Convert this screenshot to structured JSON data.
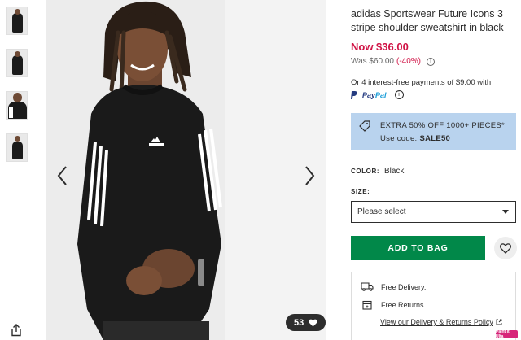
{
  "product": {
    "title": "adidas Sportswear Future Icons 3 stripe shoulder sweatshirt in black",
    "price_now": "Now $36.00",
    "was_price": "Was $60.00",
    "discount": "(-40%)",
    "installments": "Or 4 interest-free payments of $9.00 with",
    "paypal_part1": "Pay",
    "paypal_part2": "Pal"
  },
  "promo": {
    "line1": "EXTRA 50% OFF 1000+ PIECES*",
    "use_code_label": "Use code:",
    "code": "SALE50"
  },
  "color": {
    "label": "COLOR:",
    "value": "Black"
  },
  "size": {
    "label": "SIZE:",
    "placeholder": "Please select"
  },
  "actions": {
    "add_to_bag": "ADD TO BAG",
    "save_count": "53"
  },
  "delivery": {
    "free_delivery": "Free Delivery.",
    "free_returns": "Free Returns",
    "policy_link": "View our Delivery & Returns Policy"
  },
  "badge": {
    "text": "Paint It Ulta"
  },
  "icons": {
    "share": "share-icon",
    "prev": "chevron-left-icon",
    "next": "chevron-right-icon",
    "heart": "heart-icon",
    "tag": "tag-icon",
    "truck": "truck-icon",
    "returns": "returns-icon",
    "external": "external-link-icon"
  },
  "colors": {
    "sale_red": "#d01345",
    "bag_green": "#018849",
    "promo_blue": "#b9d3ee"
  }
}
